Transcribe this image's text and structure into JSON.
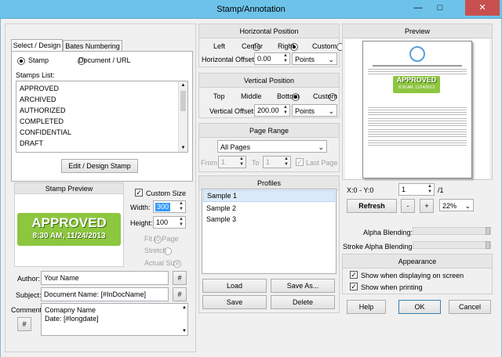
{
  "window": {
    "title": "Stamp/Annotation",
    "controls": [
      "—",
      "□",
      "✕"
    ]
  },
  "left": {
    "tabs": [
      "Select / Design",
      "Bates Numbering"
    ],
    "stamp_radio": "Stamp",
    "doc_radio": "Document / URL",
    "stamps_list_label": "Stamps List:",
    "stamps": [
      "APPROVED",
      "ARCHIVED",
      "AUTHORIZED",
      "COMPLETED",
      "CONFIDENTIAL",
      "DRAFT"
    ],
    "edit_button": "Edit / Design Stamp",
    "preview_head": "Stamp Preview",
    "stamp_line1": "APPROVED",
    "stamp_line2": "8:30 AM, 11/24/2013",
    "custom_size": "Custom Size",
    "width_label": "Width:",
    "width_value": "300",
    "height_label": "Height:",
    "height_value": "100",
    "fit_to_page": "Fit to Page",
    "stretch": "Stretch",
    "actual_size": "Actual Size",
    "author_label": "Author:",
    "author_value": "Your Name",
    "subject_label": "Subject:",
    "subject_value": "Document Name: [#InDocName]",
    "comment_label": "Comment:",
    "comment_line1": "Comapny Name",
    "comment_line2": "Date: [#longdate]",
    "hash": "#"
  },
  "middle": {
    "hpos_head": "Horizontal Position",
    "hpos_opts": [
      "Left",
      "Center",
      "Right",
      "Custom"
    ],
    "hoffset_label": "Horizontal Offset:",
    "hoffset_value": "0.00",
    "units": "Points",
    "vpos_head": "Vertical Position",
    "vpos_opts": [
      "Top",
      "Middle",
      "Bottom",
      "Custom"
    ],
    "voffset_label": "Vertical Offset:",
    "voffset_value": "200.00",
    "range_head": "Page Range",
    "range_value": "All Pages",
    "from_label": "From",
    "from_value": "1",
    "to_label": "To",
    "to_value": "1",
    "last_page": "Last Page",
    "profiles_head": "Profiles",
    "profiles": [
      "Sample 1",
      "Sample 2",
      "Sample 3"
    ],
    "load": "Load",
    "save_as": "Save As...",
    "save": "Save",
    "delete": "Delete"
  },
  "right": {
    "preview_head": "Preview",
    "page_stamp1": "APPROVED",
    "page_stamp2": "8:30 AM, 11/24/2013",
    "coords": "X:0  -  Y:0",
    "page_value": "1",
    "page_total": "/1",
    "refresh": "Refresh",
    "minus": "-",
    "plus": "+",
    "zoom": "22%",
    "alpha": "Alpha Blending:",
    "stroke_alpha": "Stroke Alpha Blending:",
    "appearance_head": "Appearance",
    "show_screen": "Show when displaying on screen",
    "show_print": "Show when printing",
    "help": "Help",
    "ok": "OK",
    "cancel": "Cancel"
  },
  "colors": {
    "stamp_green": "#8dc63f",
    "titlebar": "#6dc2e9",
    "close": "#c7504f"
  }
}
